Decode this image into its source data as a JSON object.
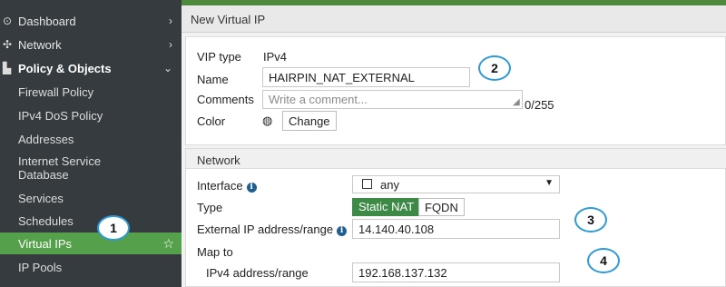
{
  "sidebar": {
    "items": [
      {
        "label": "Dashboard",
        "icon": "dashboard-icon",
        "glyph": "⊙",
        "arrow": "›"
      },
      {
        "label": "Network",
        "icon": "network-icon",
        "glyph": "✣",
        "arrow": "›"
      },
      {
        "label": "Policy & Objects",
        "icon": "policy-icon",
        "glyph": "▙",
        "arrow": "⌄"
      },
      {
        "label": "Firewall Policy"
      },
      {
        "label": "IPv4 DoS Policy"
      },
      {
        "label": "Addresses"
      },
      {
        "label": "Internet Service Database"
      },
      {
        "label": "Services"
      },
      {
        "label": "Schedules"
      },
      {
        "label": "Virtual IPs",
        "active": true
      },
      {
        "label": "IP Pools"
      }
    ]
  },
  "header": {
    "title": "New Virtual IP"
  },
  "form": {
    "vip_type_label": "VIP type",
    "vip_type_value": "IPv4",
    "name_label": "Name",
    "name_value": "HAIRPIN_NAT_EXTERNAL",
    "comments_label": "Comments",
    "comments_placeholder": "Write a comment...",
    "comments_counter": "0/255",
    "color_label": "Color",
    "color_button": "Change"
  },
  "network": {
    "section_title": "Network",
    "interface_label": "Interface",
    "interface_value": "any",
    "type_label": "Type",
    "type_options": [
      "Static NAT",
      "FQDN"
    ],
    "external_ip_label": "External IP address/range",
    "external_ip_value": "14.140.40.108",
    "map_to_label": "Map to",
    "ipv4_range_label": "IPv4 address/range",
    "ipv4_range_value": "192.168.137.132"
  },
  "callouts": [
    "1",
    "2",
    "3",
    "4"
  ],
  "colors": {
    "sidebar_bg": "#353b3f",
    "active_item": "#55a04a",
    "accent_green": "#3c8a45",
    "callout_border": "#2f9ad6"
  }
}
